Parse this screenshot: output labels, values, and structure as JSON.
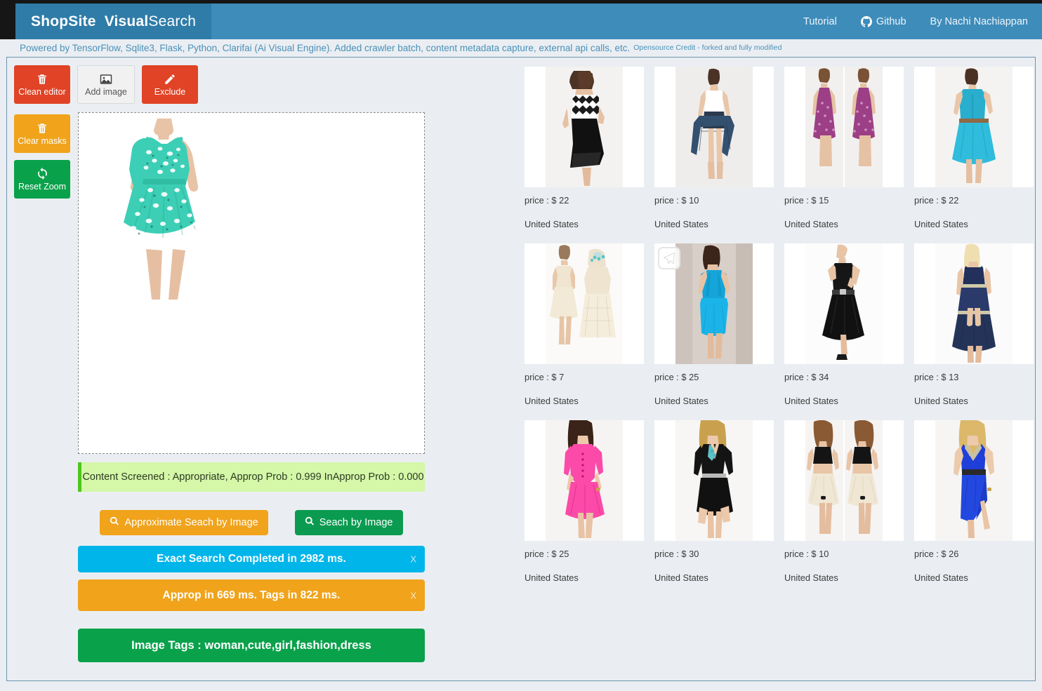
{
  "brand": {
    "bold": "ShopSite",
    "semi": "Visual",
    "light": "Search"
  },
  "nav": {
    "links": [
      {
        "label": "Tutorial",
        "icon": ""
      },
      {
        "label": "Github",
        "icon": "github-icon"
      },
      {
        "label": "By Nachi Nachiappan",
        "icon": ""
      }
    ]
  },
  "subtitle": {
    "main": "Powered by TensorFlow, Sqlite3, Flask, Python, Clarifai (Ai Visual Engine). Added crawler batch, content metadata capture, external api calls, etc.",
    "credit": "Opensource Credit - forked and fully modified"
  },
  "toolbar": {
    "clean_editor": "Clean editor",
    "add_image": "Add image",
    "exclude": "Exclude",
    "clear_masks": "Clear masks",
    "reset_zoom": "Reset Zoom"
  },
  "editor": {
    "screened_alert": "Content Screened : Appropriate, Approp Prob : 0.999 InApprop Prob : 0.000",
    "approx_search_label": "Approximate Seach by Image",
    "exact_search_label": "Seach by Image",
    "alerts": [
      {
        "name": "exact-search",
        "text": "Exact Search Completed in 2982 ms.",
        "close": "X",
        "color": "#00b5ea"
      },
      {
        "name": "approp-timing",
        "text": "Approp in 669 ms. Tags in 822 ms.",
        "close": "X",
        "color": "#f0a31b"
      },
      {
        "name": "image-tags",
        "text": "Image Tags : woman,cute,girl,fashion,dress",
        "close": "",
        "color": "#0aa14b"
      }
    ]
  },
  "colors": {
    "brand_box": "#2f7ca8",
    "navbar": "#3e8cba",
    "page_bg": "#eaeef2",
    "accent_red": "#e04326",
    "accent_orange": "#f0a31b",
    "accent_green": "#0aa14b",
    "accent_cyan": "#00b5ea",
    "screened_green": "#d4f7a8"
  },
  "results": [
    {
      "price": "price : $ 22",
      "country": "United States",
      "style": "black-chevron-dress",
      "badge": false
    },
    {
      "price": "price : $ 10",
      "country": "United States",
      "style": "white-crop-denim",
      "badge": false
    },
    {
      "price": "price : $ 15",
      "country": "United States",
      "style": "purple-print-dress",
      "badge": false
    },
    {
      "price": "price : $ 22",
      "country": "United States",
      "style": "turquoise-shirt-dress",
      "badge": false
    },
    {
      "price": "price : $ 7",
      "country": "United States",
      "style": "cream-lace-dress",
      "badge": false
    },
    {
      "price": "price : $ 25",
      "country": "United States",
      "style": "blue-ruffle-dress",
      "badge": true
    },
    {
      "price": "price : $ 34",
      "country": "United States",
      "style": "black-belted-dress",
      "badge": false
    },
    {
      "price": "price : $ 13",
      "country": "United States",
      "style": "navy-tiered-dress",
      "badge": false
    },
    {
      "price": "price : $ 25",
      "country": "United States",
      "style": "pink-romper",
      "badge": false
    },
    {
      "price": "price : $ 30",
      "country": "United States",
      "style": "black-romper",
      "badge": false
    },
    {
      "price": "price : $ 10",
      "country": "United States",
      "style": "crop-top-lace-skirt",
      "badge": false
    },
    {
      "price": "price : $ 26",
      "country": "United States",
      "style": "blue-wrap-dress",
      "badge": false
    }
  ]
}
